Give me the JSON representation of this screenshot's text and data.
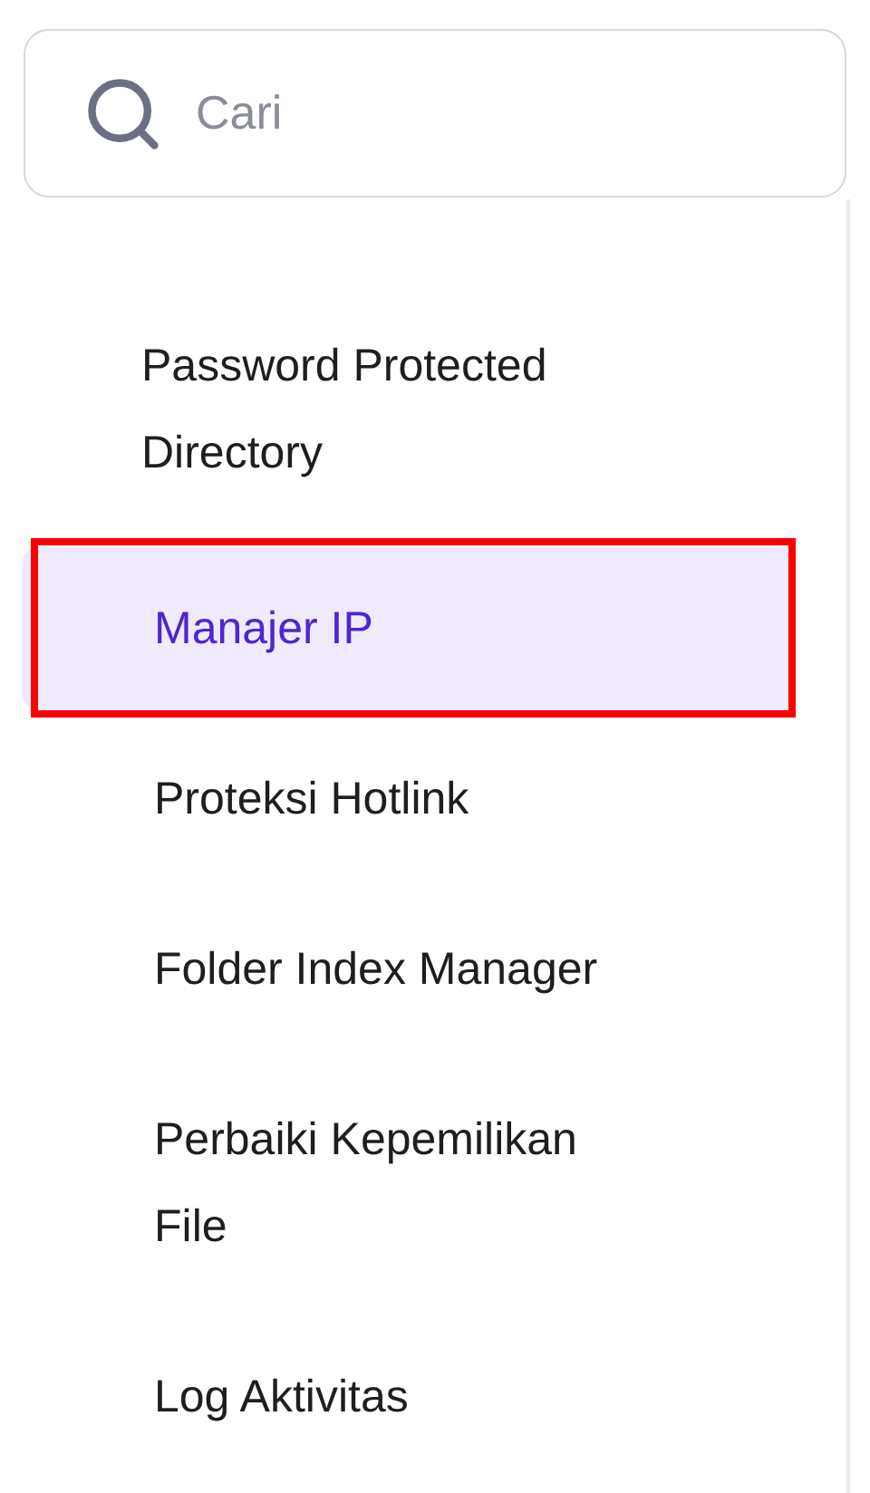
{
  "search": {
    "placeholder": "Cari"
  },
  "sidebar": {
    "items": [
      {
        "label": "Password Protected Directory",
        "selected": false,
        "outlined": false
      },
      {
        "label": "Manajer IP",
        "selected": true,
        "outlined": true
      },
      {
        "label": "Proteksi Hotlink",
        "selected": false,
        "outlined": false
      },
      {
        "label": "Folder Index Manager",
        "selected": false,
        "outlined": false
      },
      {
        "label": "Perbaiki Kepemilikan File",
        "selected": false,
        "outlined": false
      },
      {
        "label": "Log Aktivitas",
        "selected": false,
        "outlined": false
      }
    ]
  }
}
